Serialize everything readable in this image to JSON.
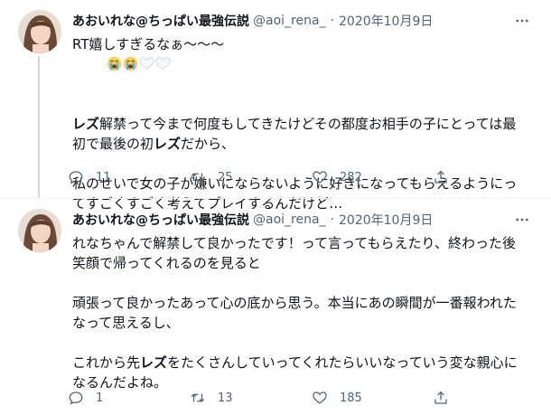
{
  "tweets": [
    {
      "author": {
        "name": "あおいれな@ちっぱい最強伝説",
        "handle": "@aoi_rena_",
        "dot": "·",
        "date": "2020年10月9日"
      },
      "paragraphs": [
        [
          {
            "t": "RT嬉しすぎるなぁ〜〜〜"
          }
        ],
        [
          {
            "t": "レズ",
            "b": true
          },
          {
            "t": "解禁って今まで何度もしてきたけどその都度お相手の子にとっては最初で最後の初"
          },
          {
            "t": "レズ",
            "b": true
          },
          {
            "t": "だから、"
          }
        ],
        [
          {
            "t": "私のせいで女の子が嫌いにならないように好きになってもらえるようにってすごくすごく考えてプレイするんだけど…"
          }
        ]
      ],
      "emojis": [
        "loudly-crying-face-emoji",
        "loudly-crying-face-emoji",
        "white-heart-emoji",
        "white-heart-emoji"
      ],
      "actions": {
        "reply": "11",
        "retweet": "25",
        "like": "282"
      }
    },
    {
      "author": {
        "name": "あおいれな@ちっぱい最強伝説",
        "handle": "@aoi_rena_",
        "dot": "·",
        "date": "2020年10月9日"
      },
      "paragraphs": [
        [
          {
            "t": "れなちゃんで解禁して良かったです！って言ってもらえたり、終わった後笑顔で帰ってくれるのを見ると"
          }
        ],
        [
          {
            "t": "頑張って良かったあって心の底から思う。本当にあの瞬間が一番報われたなって思えるし、"
          }
        ],
        [
          {
            "t": "これから先"
          },
          {
            "t": "レズ",
            "b": true
          },
          {
            "t": "をたくさんしていってくれたらいいなっていう変な親心になるんだよね。"
          }
        ]
      ],
      "emojis": [],
      "actions": {
        "reply": "1",
        "retweet": "13",
        "like": "185"
      }
    }
  ],
  "colors": {
    "text": "#0f1419",
    "secondary": "#536471",
    "divider": "#eff3f4",
    "thread": "#cfd9de"
  },
  "icons": [
    "avatar",
    "more-icon",
    "reply-icon",
    "retweet-icon",
    "like-icon",
    "share-icon"
  ]
}
